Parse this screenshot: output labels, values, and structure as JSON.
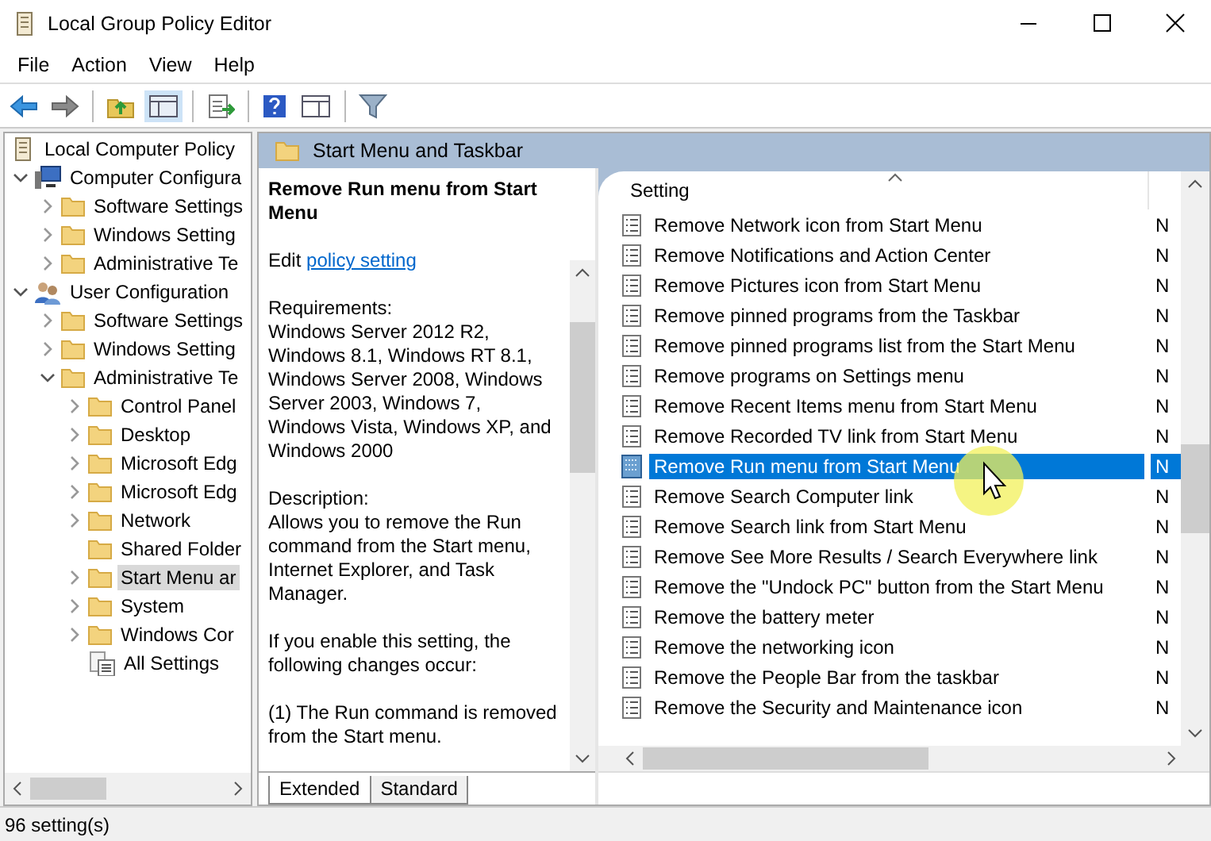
{
  "window": {
    "title": "Local Group Policy Editor"
  },
  "menu": [
    "File",
    "Action",
    "View",
    "Help"
  ],
  "tree": {
    "label": "Local Computer Policy",
    "kind": "policy",
    "selected": false,
    "children": [
      {
        "label": "Computer Configura",
        "kind": "computer",
        "expanded": true,
        "selected": false,
        "children": [
          {
            "label": "Software Settings",
            "kind": "folder",
            "expanded": false,
            "selected": false
          },
          {
            "label": "Windows Setting",
            "kind": "folder",
            "expanded": false,
            "selected": false
          },
          {
            "label": "Administrative Te",
            "kind": "folder",
            "expanded": false,
            "selected": false
          }
        ]
      },
      {
        "label": "User Configuration",
        "kind": "user",
        "expanded": true,
        "selected": false,
        "children": [
          {
            "label": "Software Settings",
            "kind": "folder",
            "expanded": false,
            "selected": false
          },
          {
            "label": "Windows Setting",
            "kind": "folder",
            "expanded": false,
            "selected": false
          },
          {
            "label": "Administrative Te",
            "kind": "folder",
            "expanded": true,
            "selected": false,
            "children": [
              {
                "label": "Control Panel",
                "kind": "folder",
                "expanded": false,
                "selected": false
              },
              {
                "label": "Desktop",
                "kind": "folder",
                "expanded": false,
                "selected": false
              },
              {
                "label": "Microsoft Edg",
                "kind": "folder",
                "expanded": false,
                "selected": false
              },
              {
                "label": "Microsoft Edg",
                "kind": "folder",
                "expanded": false,
                "selected": false
              },
              {
                "label": "Network",
                "kind": "folder",
                "expanded": false,
                "selected": false
              },
              {
                "label": "Shared Folder",
                "kind": "folder",
                "selected": false
              },
              {
                "label": "Start Menu ar",
                "kind": "folder",
                "expanded": false,
                "selected": true
              },
              {
                "label": "System",
                "kind": "folder",
                "expanded": false,
                "selected": false
              },
              {
                "label": "Windows Cor",
                "kind": "folder",
                "expanded": false,
                "selected": false
              },
              {
                "label": "All Settings",
                "kind": "settings",
                "selected": false
              }
            ]
          }
        ]
      }
    ]
  },
  "pane": {
    "title": "Start Menu and Taskbar"
  },
  "description": {
    "title": "Remove Run menu from Start Menu",
    "edit_prefix": "Edit",
    "edit_link": "policy setting",
    "requirements_label": "Requirements:",
    "requirements": "Windows Server 2012 R2, Windows 8.1, Windows RT 8.1, Windows Server 2008, Windows Server 2003, Windows 7, Windows Vista, Windows XP, and Windows 2000",
    "description_label": "Description:",
    "description": "Allows you to remove the Run command from the Start menu, Internet Explorer, and Task Manager.",
    "paragraphs": [
      "If you enable this setting, the following changes occur:",
      "(1) The Run command is removed from the Start menu."
    ]
  },
  "tabs": [
    {
      "label": "Extended",
      "selected": true
    },
    {
      "label": "Standard",
      "selected": false
    }
  ],
  "table": {
    "columns": [
      "Setting"
    ],
    "rows": [
      {
        "name": "Remove Network icon from Start Menu",
        "column_2": "N",
        "selected": false
      },
      {
        "name": "Remove Notifications and Action Center",
        "column_2": "N",
        "selected": false
      },
      {
        "name": "Remove Pictures icon from Start Menu",
        "column_2": "N",
        "selected": false
      },
      {
        "name": "Remove pinned programs from the Taskbar",
        "column_2": "N",
        "selected": false
      },
      {
        "name": "Remove pinned programs list from the Start Menu",
        "column_2": "N",
        "selected": false
      },
      {
        "name": "Remove programs on Settings menu",
        "column_2": "N",
        "selected": false
      },
      {
        "name": "Remove Recent Items menu from Start Menu",
        "column_2": "N",
        "selected": false
      },
      {
        "name": "Remove Recorded TV link from Start Menu",
        "column_2": "N",
        "selected": false
      },
      {
        "name": "Remove Run menu from Start Menu",
        "column_2": "N",
        "selected": true
      },
      {
        "name": "Remove Search Computer link",
        "column_2": "N",
        "selected": false
      },
      {
        "name": "Remove Search link from Start Menu",
        "column_2": "N",
        "selected": false
      },
      {
        "name": "Remove See More Results / Search Everywhere link",
        "column_2": "N",
        "selected": false
      },
      {
        "name": "Remove the \"Undock PC\" button from the Start Menu",
        "column_2": "N",
        "selected": false
      },
      {
        "name": "Remove the battery meter",
        "column_2": "N",
        "selected": false
      },
      {
        "name": "Remove the networking icon",
        "column_2": "N",
        "selected": false
      },
      {
        "name": "Remove the People Bar from the taskbar",
        "column_2": "N",
        "selected": false
      },
      {
        "name": "Remove the Security and Maintenance icon",
        "column_2": "N",
        "selected": false
      }
    ]
  },
  "status_bar": "96 setting(s)"
}
